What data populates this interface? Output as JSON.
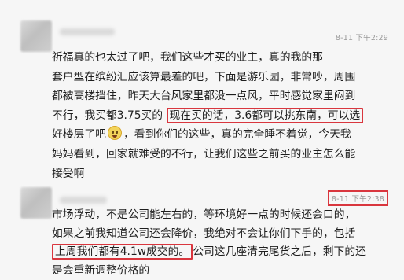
{
  "comments": [
    {
      "time": "8-11 下午2:29",
      "lines": [
        [
          "祈福真的也太过了吧，我们这些才买的业主，真的我的那"
        ],
        [
          "套户型在缤纷汇应该算最差的吧，下面是游乐园，非常吵，周围"
        ],
        [
          "都被高楼挡住，昨天大台风家里都没一点风，平时感觉家里闷到"
        ],
        [
          "不行，我买都3.75买的",
          "现在买的话，3.6都可以挑东南，可以选"
        ],
        [
          "好楼层了吧",
          "，看到你们的这些，真的完全睡不着觉，今天我"
        ],
        [
          "妈妈看到，回家就难受的不行，让我们这些之前买的业主怎么能"
        ],
        [
          "接受啊"
        ]
      ]
    },
    {
      "time": "8-11 下午2:38",
      "lines": [
        [
          "市场浮动，不是公司能左右的，等环境好一点的时候还会口的，"
        ],
        [
          "如果之前我知道公司还会降价，我绝对不会让你们下手的，包括"
        ],
        [
          "上周我们都有4.1w成交的。",
          "公司这几座清完尾货之后，剩下的还"
        ],
        [
          "是会重新调整价格的"
        ]
      ]
    }
  ]
}
